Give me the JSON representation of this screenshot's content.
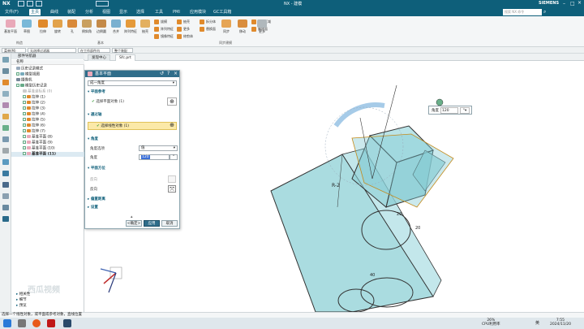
{
  "app": {
    "logo": "NX",
    "title": "NX - 建模",
    "brand": "SIEMENS",
    "search_placeholder": "搜索 NX 命令"
  },
  "menu": [
    "文件(F)",
    "主页",
    "曲线",
    "装配",
    "分析",
    "视图",
    "显示",
    "选择",
    "工具",
    "PMI",
    "应用模块",
    "GC工具箱"
  ],
  "ribbon": {
    "buttons": [
      "基准平面",
      "草图",
      "拉伸",
      "旋转",
      "孔",
      "倒斜角",
      "边倒圆",
      "合并",
      "阵列特征",
      "抽壳",
      "拔模",
      "图纸页"
    ],
    "small": [
      "拔模",
      "阵列特征",
      "镜像特征",
      "抽壳",
      "更多",
      "修剪体",
      "拆分体",
      "替换面",
      "偏置区域",
      "移动面",
      "删除面",
      "更多"
    ],
    "right_buttons": [
      "同步",
      "移动",
      "更多"
    ],
    "groups": [
      "构造",
      "基本",
      "同步建模"
    ],
    "extra_button": "更多"
  },
  "selbar": {
    "filter": "菜单(M)",
    "scope": "无选择过滤器",
    "assembly": "在工作部件内",
    "snap": "整个装配"
  },
  "tabs": [
    "发现中心",
    "Sfc.prt"
  ],
  "navigator": {
    "title": "部件导航器",
    "col": "名称",
    "rows": [
      "历史记录模式",
      "模型视图",
      "摄像机",
      "模型历史记录",
      "基准坐标系 (0)",
      "拉伸 (1)",
      "拉伸 (2)",
      "拉伸 (3)",
      "拉伸 (4)",
      "拉伸 (5)",
      "拉伸 (6)",
      "拉伸 (7)",
      "基准平面 (8)",
      "基准平面 (9)",
      "基准平面 (10)",
      "基准平面 (11)"
    ],
    "footer": [
      "相关性",
      "细节",
      "预览"
    ]
  },
  "dialog": {
    "title": "基本平面",
    "type_value": "成一角度",
    "sec_ref": "平面参考",
    "ref_label": "选择平面对象 (1)",
    "sec_axis": "通过轴",
    "axis_label": "选择线性对象 (1)",
    "sec_angle": "角度",
    "angle_option_label": "角度选项",
    "angle_option_value": "值",
    "angle_label": "角度",
    "angle_value": "120",
    "angle_unit": "°",
    "sec_dir": "平面方位",
    "dir_label": "反向",
    "reverse_label": "反向",
    "sec_settings": "偏置距离",
    "sec_more": "设置",
    "btn_ok": "<确定>",
    "btn_apply": "应用",
    "btn_cancel": "取消"
  },
  "viewport": {
    "angle_label": "角度",
    "angle_value": "120",
    "dim1": "R-2",
    "dim2": "20",
    "dim3": "20",
    "dim4": "40"
  },
  "statusbar": {
    "text": "选择一个线性对象，或平面或参考对象，直线位置"
  },
  "taskbar": {
    "time": "7:55",
    "date": "2024/11/20",
    "cpu": "26%",
    "cpu_label": "CPU利用率",
    "lang": "英"
  },
  "watermark": "西瓜视频",
  "colors": {
    "primary": "#0e5f7a",
    "highlight": "#fbe9a8",
    "body": "#7ec8d1"
  }
}
